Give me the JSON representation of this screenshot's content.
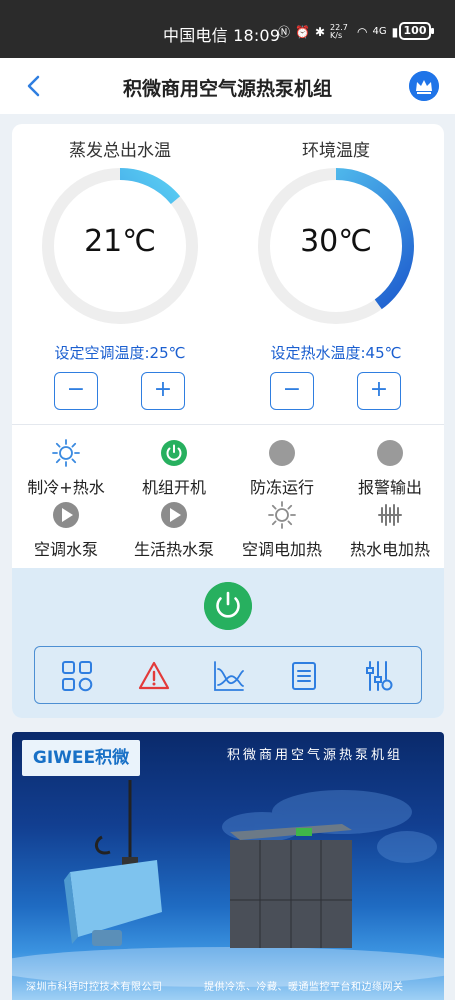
{
  "status_bar": {
    "carrier_time": "中国电信 18:09",
    "net_speed": "22.7 K/s",
    "signal": "4G",
    "battery": "100"
  },
  "header": {
    "title": "积微商用空气源热泵机组",
    "back_icon": "chevron-left-icon",
    "vip_icon": "crown-icon"
  },
  "gauges": [
    {
      "label": "蒸发总出水温",
      "value": "21℃",
      "fill_fraction": 0.14,
      "color": "#3aa0ea"
    },
    {
      "label": "环境温度",
      "value": "30℃",
      "fill_fraction": 0.4,
      "color": "#3aa0ea"
    }
  ],
  "setpoints": {
    "ac_label": "设定空调温度:25℃",
    "hot_water_label": "设定热水温度:45℃",
    "minus": "−",
    "plus": "+"
  },
  "status_items": [
    {
      "label": "制冷+热水",
      "icon": "sun-icon"
    },
    {
      "label": "机组开机",
      "icon": "power-on-icon"
    },
    {
      "label": "防冻运行",
      "icon": "gray-dot-icon"
    },
    {
      "label": "报警输出",
      "icon": "gray-dot-icon"
    },
    {
      "label": "空调水泵",
      "icon": "play-icon"
    },
    {
      "label": "生活热水泵",
      "icon": "play-icon"
    },
    {
      "label": "空调电加热",
      "icon": "sun-gray-icon"
    },
    {
      "label": "热水电加热",
      "icon": "heater-icon"
    }
  ],
  "toolbar": {
    "items": [
      "grid-icon",
      "alarm-icon",
      "chart-icon",
      "list-icon",
      "settings-sliders-icon"
    ]
  },
  "banner": {
    "logo": "GIWEE积微",
    "title": "积微商用空气源热泵机组",
    "footer_left": "深圳市科特时控技术有限公司",
    "footer_right": "提供冷冻、冷藏、暖通监控平台和边缘网关"
  },
  "colors": {
    "accent": "#2f7ee0",
    "power_green": "#27b05f",
    "alarm_red": "#e33a3a"
  }
}
